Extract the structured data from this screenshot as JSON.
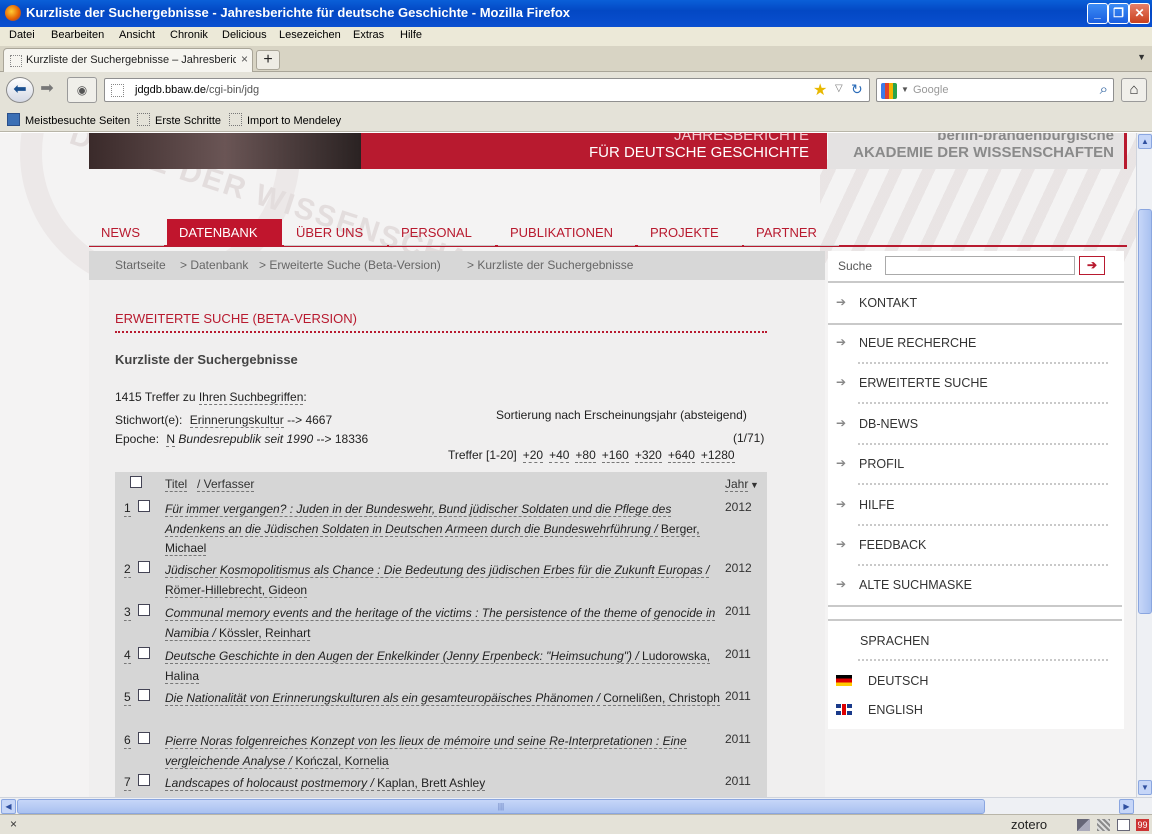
{
  "window": {
    "title": "Kurzliste der Suchergebnisse - Jahresberichte für deutsche Geschichte - Mozilla Firefox",
    "min": "_",
    "max": "❐",
    "close": "✕"
  },
  "menu": [
    "Datei",
    "Bearbeiten",
    "Ansicht",
    "Chronik",
    "Delicious",
    "Lesezeichen",
    "Extras",
    "Hilfe"
  ],
  "tab": {
    "label": "Kurzliste der Suchergebnisse – Jahresbericht...",
    "close": "×",
    "new": "+"
  },
  "navbar": {
    "url_host": "jdgdb.bbaw.de",
    "url_path": "/cgi-bin/jdg",
    "search_placeholder": "Google"
  },
  "bookmarks": [
    "Meistbesuchte Seiten",
    "Erste Schritte",
    "Import to Mendeley"
  ],
  "banner": {
    "line1": "JAHRESBERICHTE",
    "line2": "FÜR DEUTSCHE GESCHICHTE",
    "acad1": "berlin-brandenburgische",
    "acad2": "AKADEMIE DER WISSENSCHAFTEN",
    "seal_text": "DEMIE DER WISSENSCHAF"
  },
  "mainnav": [
    "NEWS",
    "DATENBANK",
    "ÜBER UNS",
    "PERSONAL",
    "PUBLIKATIONEN",
    "PROJEKTE",
    "PARTNER"
  ],
  "breadcrumbs": [
    "Startseite",
    "> Datenbank",
    "> Erweiterte Suche (Beta-Version)",
    "> Kurzliste der Suchergebnisse"
  ],
  "content": {
    "heading": "ERWEITERTE SUCHE (BETA-VERSION)",
    "subheading": "Kurzliste der Suchergebnisse",
    "hits_count": "1415 Treffer zu",
    "hits_link": "Ihren Suchbegriffen",
    "stichwort_label": "Stichwort(e):",
    "stichwort_value": "Erinnerungskultur",
    "stichwort_count": "--> 4667",
    "epoche_label": "Epoche:",
    "epoche_code": "N",
    "epoche_value": "Bundesrepublik seit 1990",
    "epoche_count": "--> 18336",
    "sort": "Sortierung nach Erscheinungsjahr (absteigend)",
    "page_info": "(1/71)",
    "treffer": "Treffer [1-20]",
    "pages": [
      "+20",
      "+40",
      "+80",
      "+160",
      "+320",
      "+640",
      "+1280"
    ]
  },
  "table": {
    "col_title": "Titel",
    "col_author": "/ Verfasser",
    "col_year": "Jahr",
    "sort_icon": "▼",
    "rows": [
      {
        "num": "1",
        "title": "Für immer vergangen? : Juden in der Bundeswehr, Bund jüdischer Soldaten und die Pflege des Andenkens an die Jüdischen Soldaten in Deutschen Armeen durch die Bundeswehrführung /",
        "author": "Berger, Michael",
        "year": "2012"
      },
      {
        "num": "2",
        "title": "Jüdischer Kosmopolitismus als Chance : Die Bedeutung des jüdischen Erbes für die Zukunft Europas /",
        "author": "Römer-Hillebrecht, Gideon",
        "year": "2012"
      },
      {
        "num": "3",
        "title": "Communal memory events and the heritage of the victims : The persistence of the theme of genocide in Namibia /",
        "author": "Kössler, Reinhart",
        "year": "2011"
      },
      {
        "num": "4",
        "title": "Deutsche Geschichte in den Augen der Enkelkinder (Jenny Erpenbeck: \"Heimsuchung\") /",
        "author": "Ludorowska, Halina",
        "year": "2011"
      },
      {
        "num": "5",
        "title": "Die Nationalität von Erinnerungskulturen als ein gesamteuropäisches Phänomen /",
        "author": "Cornelißen, Christoph",
        "year": "2011"
      },
      {
        "num": "6",
        "title": "Pierre Noras folgenreiches Konzept von les lieux de mémoire und seine Re-Interpretationen : Eine vergleichende Analyse /",
        "author": "Kończal, Kornelia",
        "year": "2011"
      },
      {
        "num": "7",
        "title": "Landscapes of holocaust postmemory /",
        "author": "Kaplan, Brett Ashley",
        "year": "2011"
      }
    ]
  },
  "sidebar": {
    "search_label": "Suche",
    "search_go": "➔",
    "arrow": "➔",
    "items": [
      "KONTAKT",
      "NEUE RECHERCHE",
      "ERWEITERTE SUCHE",
      "DB-NEWS",
      "PROFIL",
      "HILFE",
      "FEEDBACK",
      "ALTE SUCHMASKE"
    ],
    "languages_heading": "SPRACHEN",
    "languages": [
      "DEUTSCH",
      "ENGLISH"
    ]
  },
  "status": {
    "close": "×",
    "zotero": "zotero"
  },
  "colors": {
    "brand_red": "#b81a2f",
    "grey": "#d7d7d7"
  }
}
